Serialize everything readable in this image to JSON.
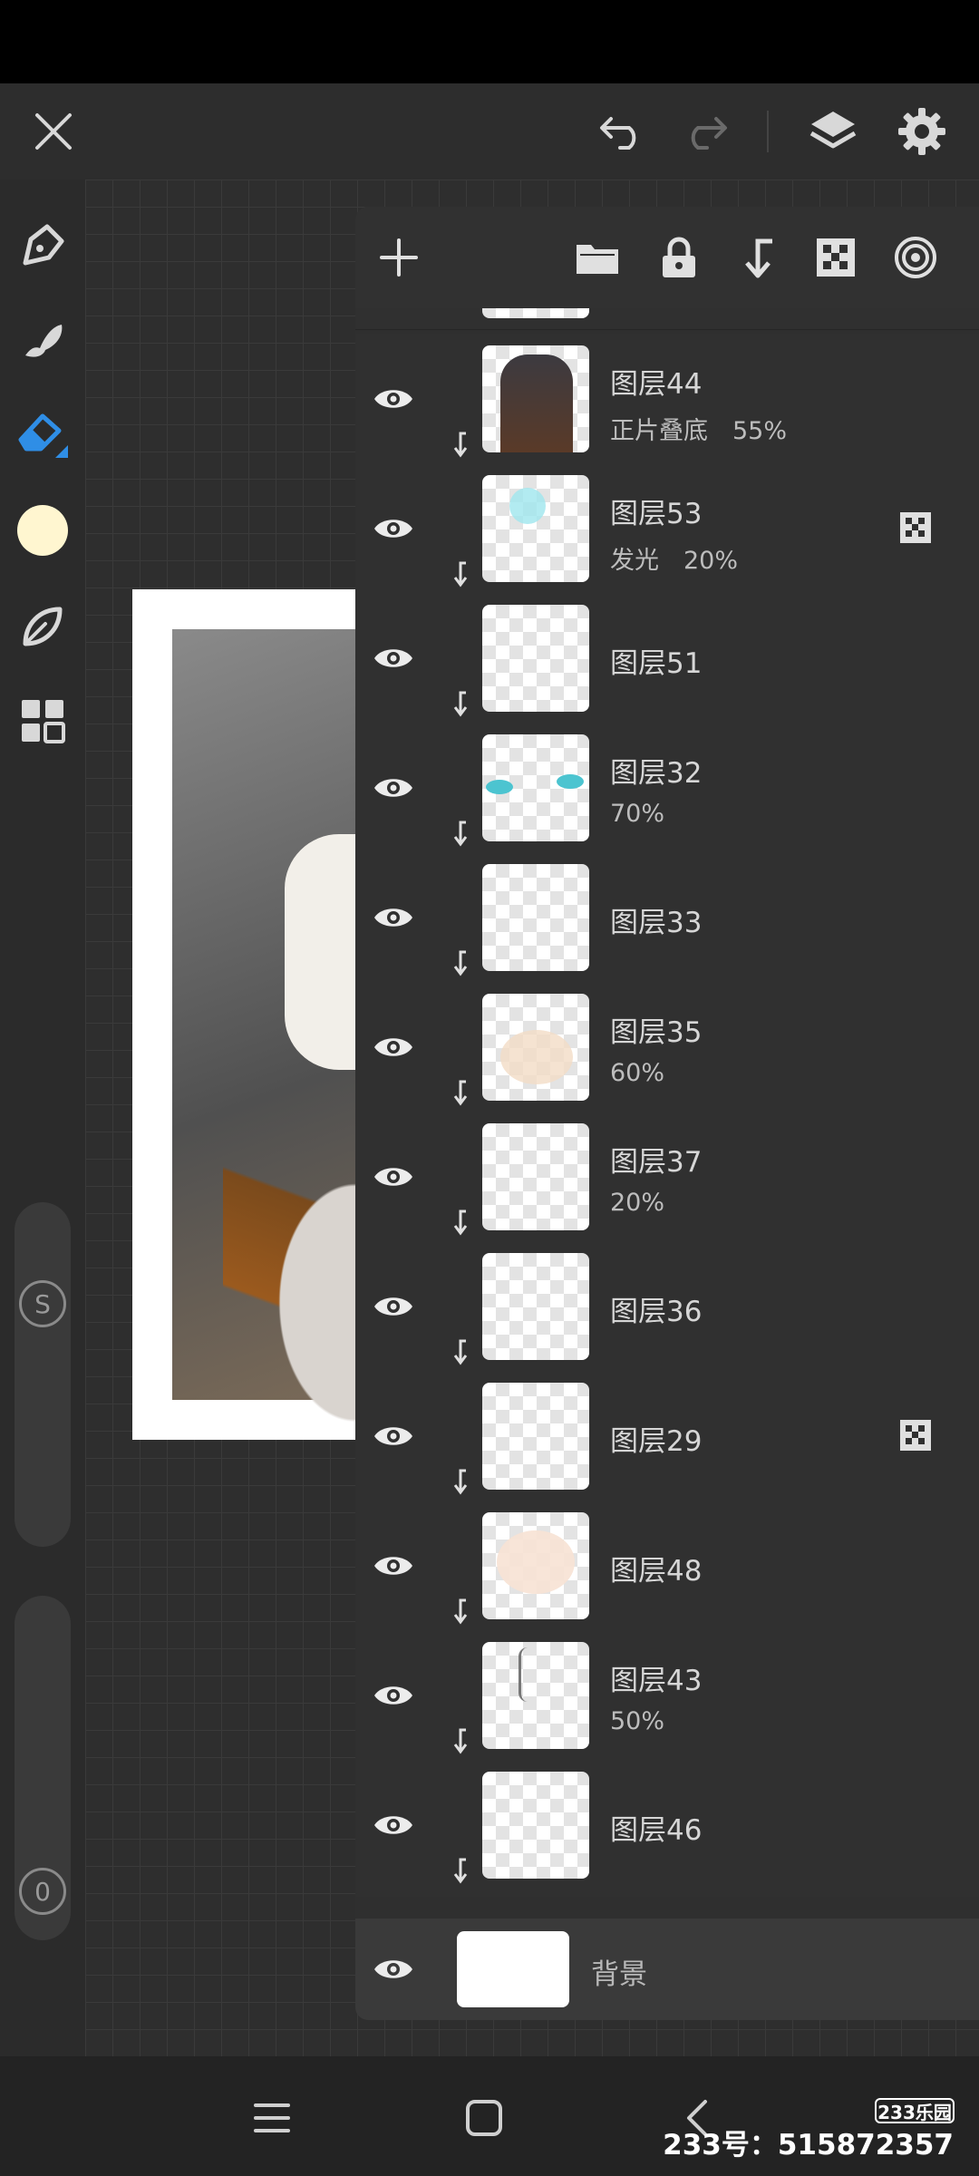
{
  "colors": {
    "accent_blue": "#2f8ee6",
    "current_color": "#fff6d0",
    "panel_bg": "#2f2f2f",
    "icon_light": "#d8d8d8"
  },
  "top_bar": {
    "icons": [
      "close-icon",
      "undo-icon",
      "redo-icon",
      "layers-icon",
      "settings-icon"
    ]
  },
  "tools": [
    "pen-icon",
    "smudge-icon",
    "eraser-icon",
    "color-swatch",
    "leaf-brush-icon",
    "grid-icon"
  ],
  "sliders": {
    "size_label": "S",
    "opacity_label": "0"
  },
  "layer_panel": {
    "header_icons": [
      "add-icon",
      "folder-icon",
      "lock-icon",
      "clip-down-icon",
      "transparency-icon",
      "target-icon"
    ],
    "layers": [
      {
        "name": "图层44",
        "mode": "正片叠底　55%",
        "alpha_lock": false
      },
      {
        "name": "图层53",
        "mode": "发光　20%",
        "alpha_lock": true
      },
      {
        "name": "图层51",
        "mode": "",
        "alpha_lock": false
      },
      {
        "name": "图层32",
        "mode": "70%",
        "alpha_lock": false
      },
      {
        "name": "图层33",
        "mode": "",
        "alpha_lock": false
      },
      {
        "name": "图层35",
        "mode": "60%",
        "alpha_lock": false
      },
      {
        "name": "图层37",
        "mode": "20%",
        "alpha_lock": false
      },
      {
        "name": "图层36",
        "mode": "",
        "alpha_lock": false
      },
      {
        "name": "图层29",
        "mode": "",
        "alpha_lock": true
      },
      {
        "name": "图层48",
        "mode": "",
        "alpha_lock": false
      },
      {
        "name": "图层43",
        "mode": "50%",
        "alpha_lock": false
      },
      {
        "name": "图层46",
        "mode": "",
        "alpha_lock": false
      }
    ],
    "background_layer": {
      "name": "背景"
    }
  },
  "bottom_nav": [
    "menu-icon",
    "home-icon",
    "back-icon"
  ],
  "watermark": {
    "logo": "233乐园",
    "text": "233号：515872357"
  }
}
